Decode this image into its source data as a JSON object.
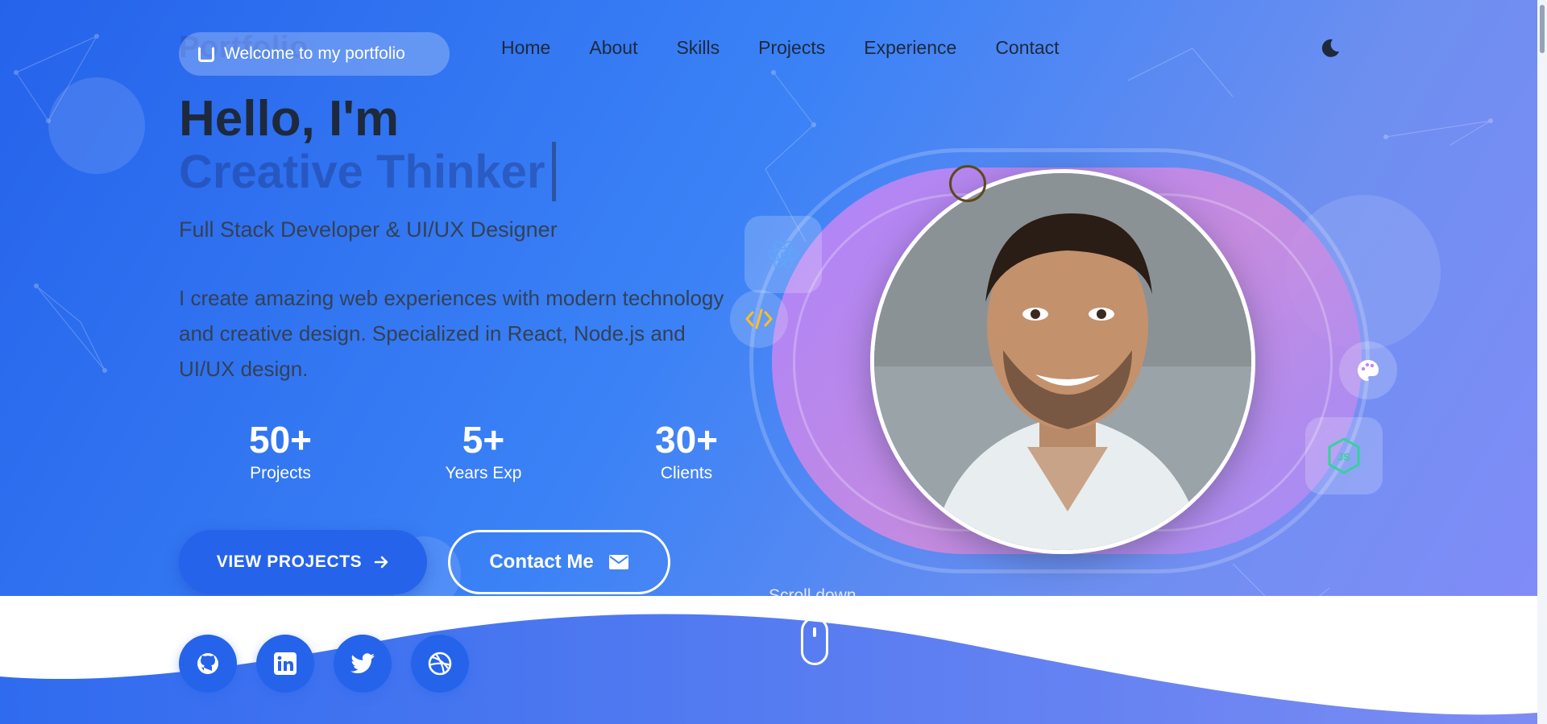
{
  "header": {
    "logo": "Portfolio",
    "badge": "Welcome to my portfolio",
    "nav": [
      "Home",
      "About",
      "Skills",
      "Projects",
      "Experience",
      "Contact"
    ],
    "theme_toggle_icon": "moon-icon"
  },
  "hero": {
    "greeting": "Hello, I'm",
    "typed_text": "Creative Thinker",
    "role": "Full Stack Developer & UI/UX Designer",
    "description": "I create amazing web experiences with modern technology and creative design. Specialized in React, Node.js and UI/UX design.",
    "stats": [
      {
        "value": "50+",
        "label": "Projects"
      },
      {
        "value": "5+",
        "label": "Years Exp"
      },
      {
        "value": "30+",
        "label": "Clients"
      }
    ],
    "primary_button": "VIEW PROJECTS",
    "secondary_button": "Contact Me",
    "socials": [
      "github-icon",
      "linkedin-icon",
      "twitter-icon",
      "dribbble-icon"
    ],
    "scroll_label": "Scroll down",
    "floating_icons": [
      "react-icon",
      "code-icon",
      "palette-icon",
      "nodejs-icon"
    ]
  },
  "colors": {
    "primary": "#2563eb",
    "accent": "#c084fc",
    "text": "#1e293b"
  }
}
